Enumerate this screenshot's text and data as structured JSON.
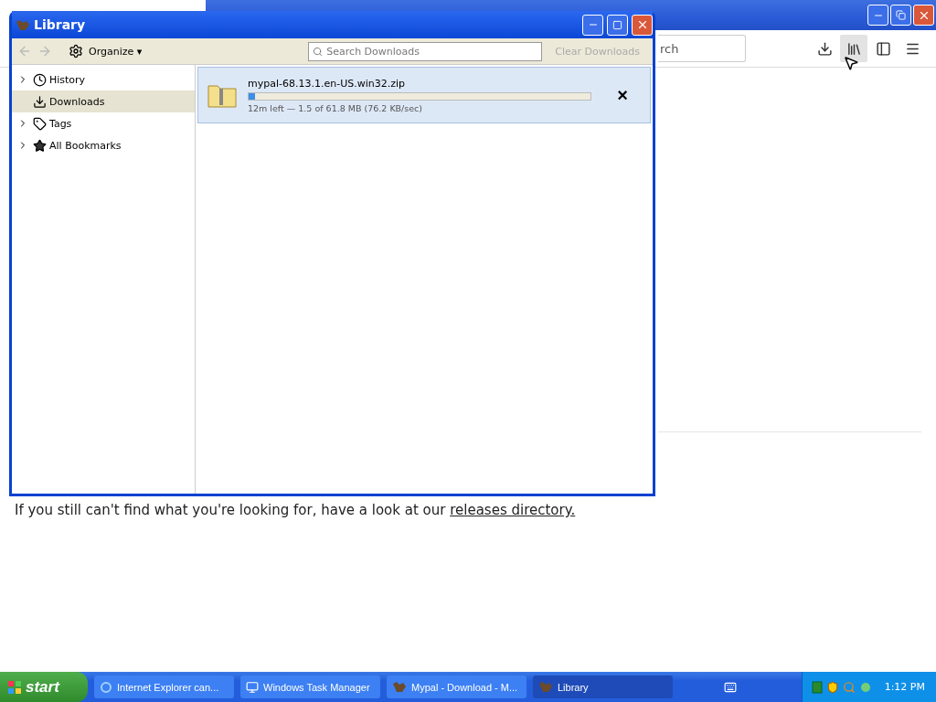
{
  "browser": {
    "search": {
      "placeholder": "rch"
    },
    "toolbar": [
      {
        "kind": "download"
      },
      {
        "kind": "library",
        "selected": true
      },
      {
        "kind": "sidebar"
      },
      {
        "kind": "menu"
      }
    ],
    "text": "If you still can't find what you're looking for, have a look at our",
    "link": "releases directory."
  },
  "library": {
    "title": "Library",
    "toolbar": {
      "organize": "Organize",
      "organize_caret": "▾",
      "search": {
        "placeholder": "Search Downloads"
      },
      "clear": {
        "label": "Clear Downloads",
        "disabled": true
      }
    },
    "sidebar": [
      {
        "label": "History",
        "kind": "clock",
        "expandable": true,
        "selected": false
      },
      {
        "label": "Downloads",
        "kind": "download",
        "expandable": false,
        "selected": true
      },
      {
        "label": "Tags",
        "kind": "tag",
        "expandable": true,
        "selected": false
      },
      {
        "label": "All Bookmarks",
        "kind": "star",
        "expandable": true,
        "selected": false
      }
    ],
    "downloads": [
      {
        "name": "mypal-68.13.1.en-US.win32.zip",
        "level": 0.02,
        "status": "12m left — 1.5 of 61.8 MB (76.2 KB/sec)",
        "selected": true,
        "cancel": "×"
      }
    ]
  },
  "taskbar": {
    "start": "start",
    "tasks": [
      {
        "label": "Internet Explorer can...",
        "kind": "ie",
        "selected": false
      },
      {
        "label": "Windows Task Manager",
        "kind": "monitor",
        "selected": false
      },
      {
        "label": "Mypal - Download - M...",
        "kind": "mypal",
        "selected": false
      },
      {
        "label": "Library",
        "kind": "mypal",
        "selected": true
      }
    ],
    "clock": "1:12 PM"
  }
}
